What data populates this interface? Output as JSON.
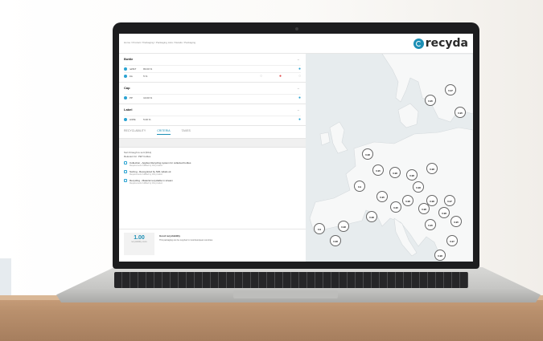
{
  "app": {
    "brand": "recyda"
  },
  "breadcrumb": "Home / Product / Packaging / Packaging Lists / Details / Packaging",
  "sections": [
    {
      "title": "Bottle",
      "rows": [
        {
          "name": "rePET",
          "value": "80.00 %",
          "status_icon": "check-icon"
        },
        {
          "name": "Ink",
          "value": "5 %",
          "status_icon": "warning-icon"
        }
      ]
    },
    {
      "title": "Cap",
      "rows": [
        {
          "name": "PP",
          "value": "10.00 %",
          "status_icon": "check-icon"
        }
      ]
    },
    {
      "title": "Label",
      "rows": [
        {
          "name": "LDPE",
          "value": "5.00 %",
          "status_icon": "check-icon"
        }
      ]
    }
  ],
  "tabs": [
    "RECYCLABILITY",
    "CRITERIA",
    "TAXES"
  ],
  "criteria": {
    "heading": "Sort through to sort (9/11)",
    "subheading": "Relevant for: PET bottles",
    "items": [
      {
        "title": "Collection - Applies Recycling system for collected bottles",
        "sub": "Requirements fulfilled by this product"
      },
      {
        "title": "Sorting - Recognized by NIR, labels ok",
        "sub": "Requirements fulfilled by this product"
      },
      {
        "title": "Recycling - Material recyclable in stream",
        "sub": "Requirements fulfilled by this product"
      }
    ]
  },
  "score": {
    "value": "1.00",
    "badge_sub": "recyclability score",
    "heading": "Good recyclability",
    "text": "This packaging can be recycled in most European countries."
  },
  "map_bubbles": [
    "0.97",
    "0.95",
    "0.95",
    "0.98",
    "0.95",
    "0.98",
    "0.98",
    "0.98",
    "0.98",
    "0.98",
    "0.98",
    "0.97",
    "0.95",
    "0.98",
    "0.98",
    "0.95",
    "0.9",
    "0.95",
    "0.98",
    "0.98",
    "0.9",
    "0.95",
    "0.98",
    "0.97",
    "0.98"
  ]
}
